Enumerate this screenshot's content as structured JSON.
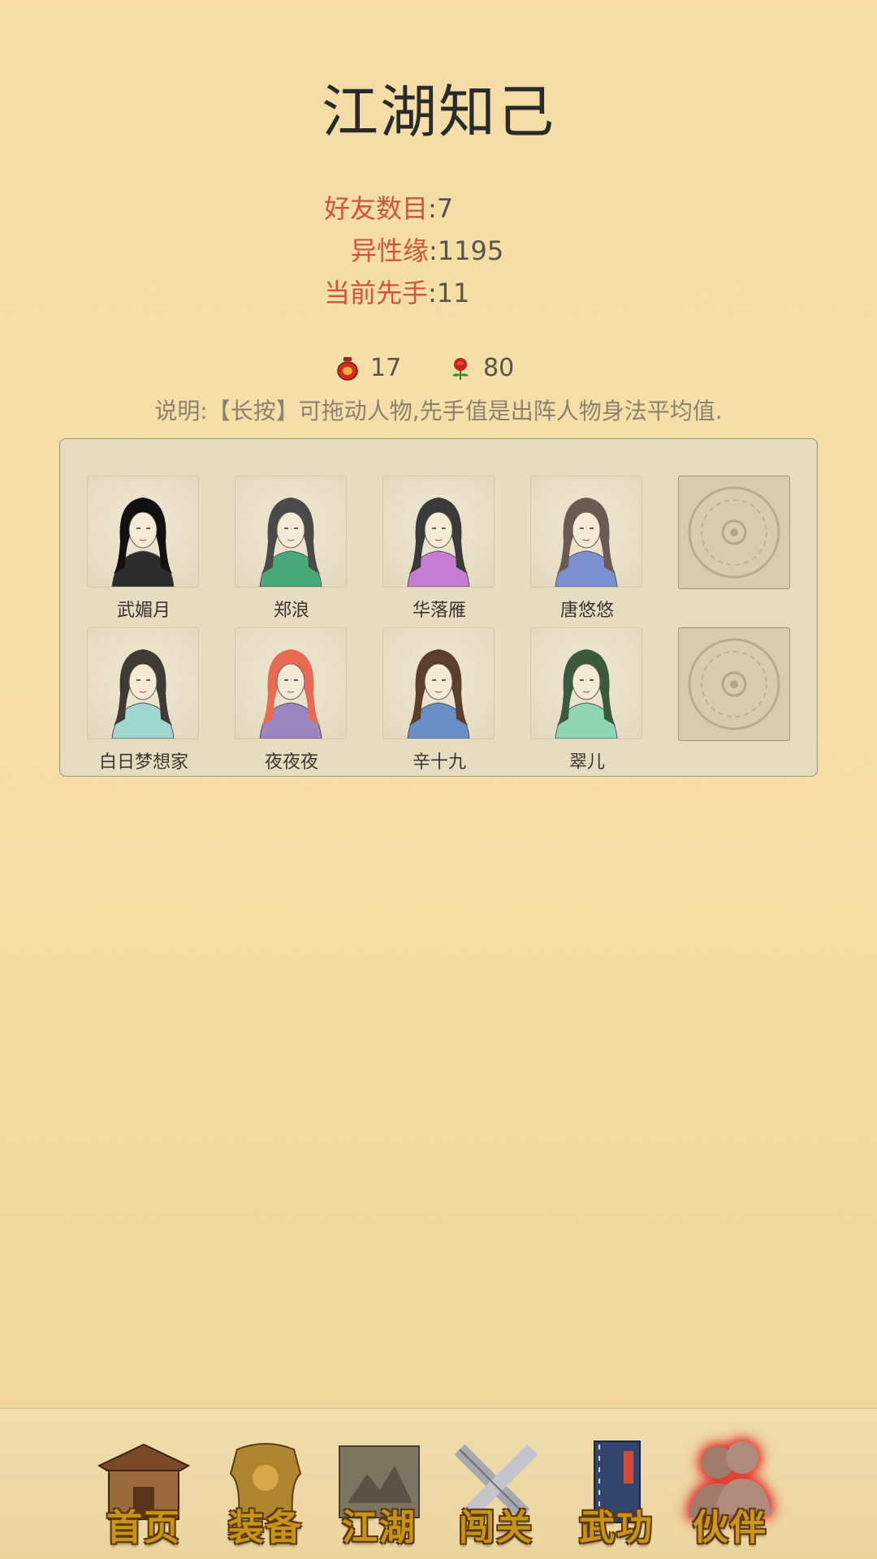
{
  "title": "江湖知己",
  "stats": [
    {
      "label": "好友数目",
      "sep": ":",
      "value": "7"
    },
    {
      "label": "异性缘",
      "sep": ":",
      "value": "1195"
    },
    {
      "label": "当前先手",
      "sep": ":",
      "value": "11"
    }
  ],
  "resources": [
    {
      "icon": "wine-jar-icon",
      "value": "17"
    },
    {
      "icon": "rose-icon",
      "value": "80"
    }
  ],
  "note": "说明:【长按】可拖动人物,先手值是出阵人物身法平均值.",
  "companions": [
    {
      "name": "武媚月",
      "hair": "#111111",
      "robe": "#2c2c2c"
    },
    {
      "name": "郑浪",
      "hair": "#4a4a4a",
      "robe": "#48a978"
    },
    {
      "name": "华落雁",
      "hair": "#3a3a3a",
      "robe": "#c77cd6"
    },
    {
      "name": "唐悠悠",
      "hair": "#6a5b52",
      "robe": "#7c8fd0"
    },
    {
      "name": "白日梦想家",
      "hair": "#3f3a33",
      "robe": "#9fd7cf"
    },
    {
      "name": "夜夜夜",
      "hair": "#e86a52",
      "robe": "#9c86c2"
    },
    {
      "name": "辛十九",
      "hair": "#5b3f2c",
      "robe": "#6a8fc6"
    },
    {
      "name": "翠儿",
      "hair": "#3b5a3d",
      "robe": "#8fd4b3"
    }
  ],
  "empty_slots": 2,
  "nav": [
    {
      "label": "首页",
      "icon": "house-icon"
    },
    {
      "label": "装备",
      "icon": "armor-icon"
    },
    {
      "label": "江湖",
      "icon": "scroll-map-icon"
    },
    {
      "label": "闯关",
      "icon": "crossed-swords-icon"
    },
    {
      "label": "武功",
      "icon": "martial-book-icon"
    },
    {
      "label": "伙伴",
      "icon": "companions-icon",
      "active": true
    }
  ],
  "colors": {
    "accent": "#cf5537",
    "background": "#f4dca5",
    "nav_text": "#c89418"
  }
}
